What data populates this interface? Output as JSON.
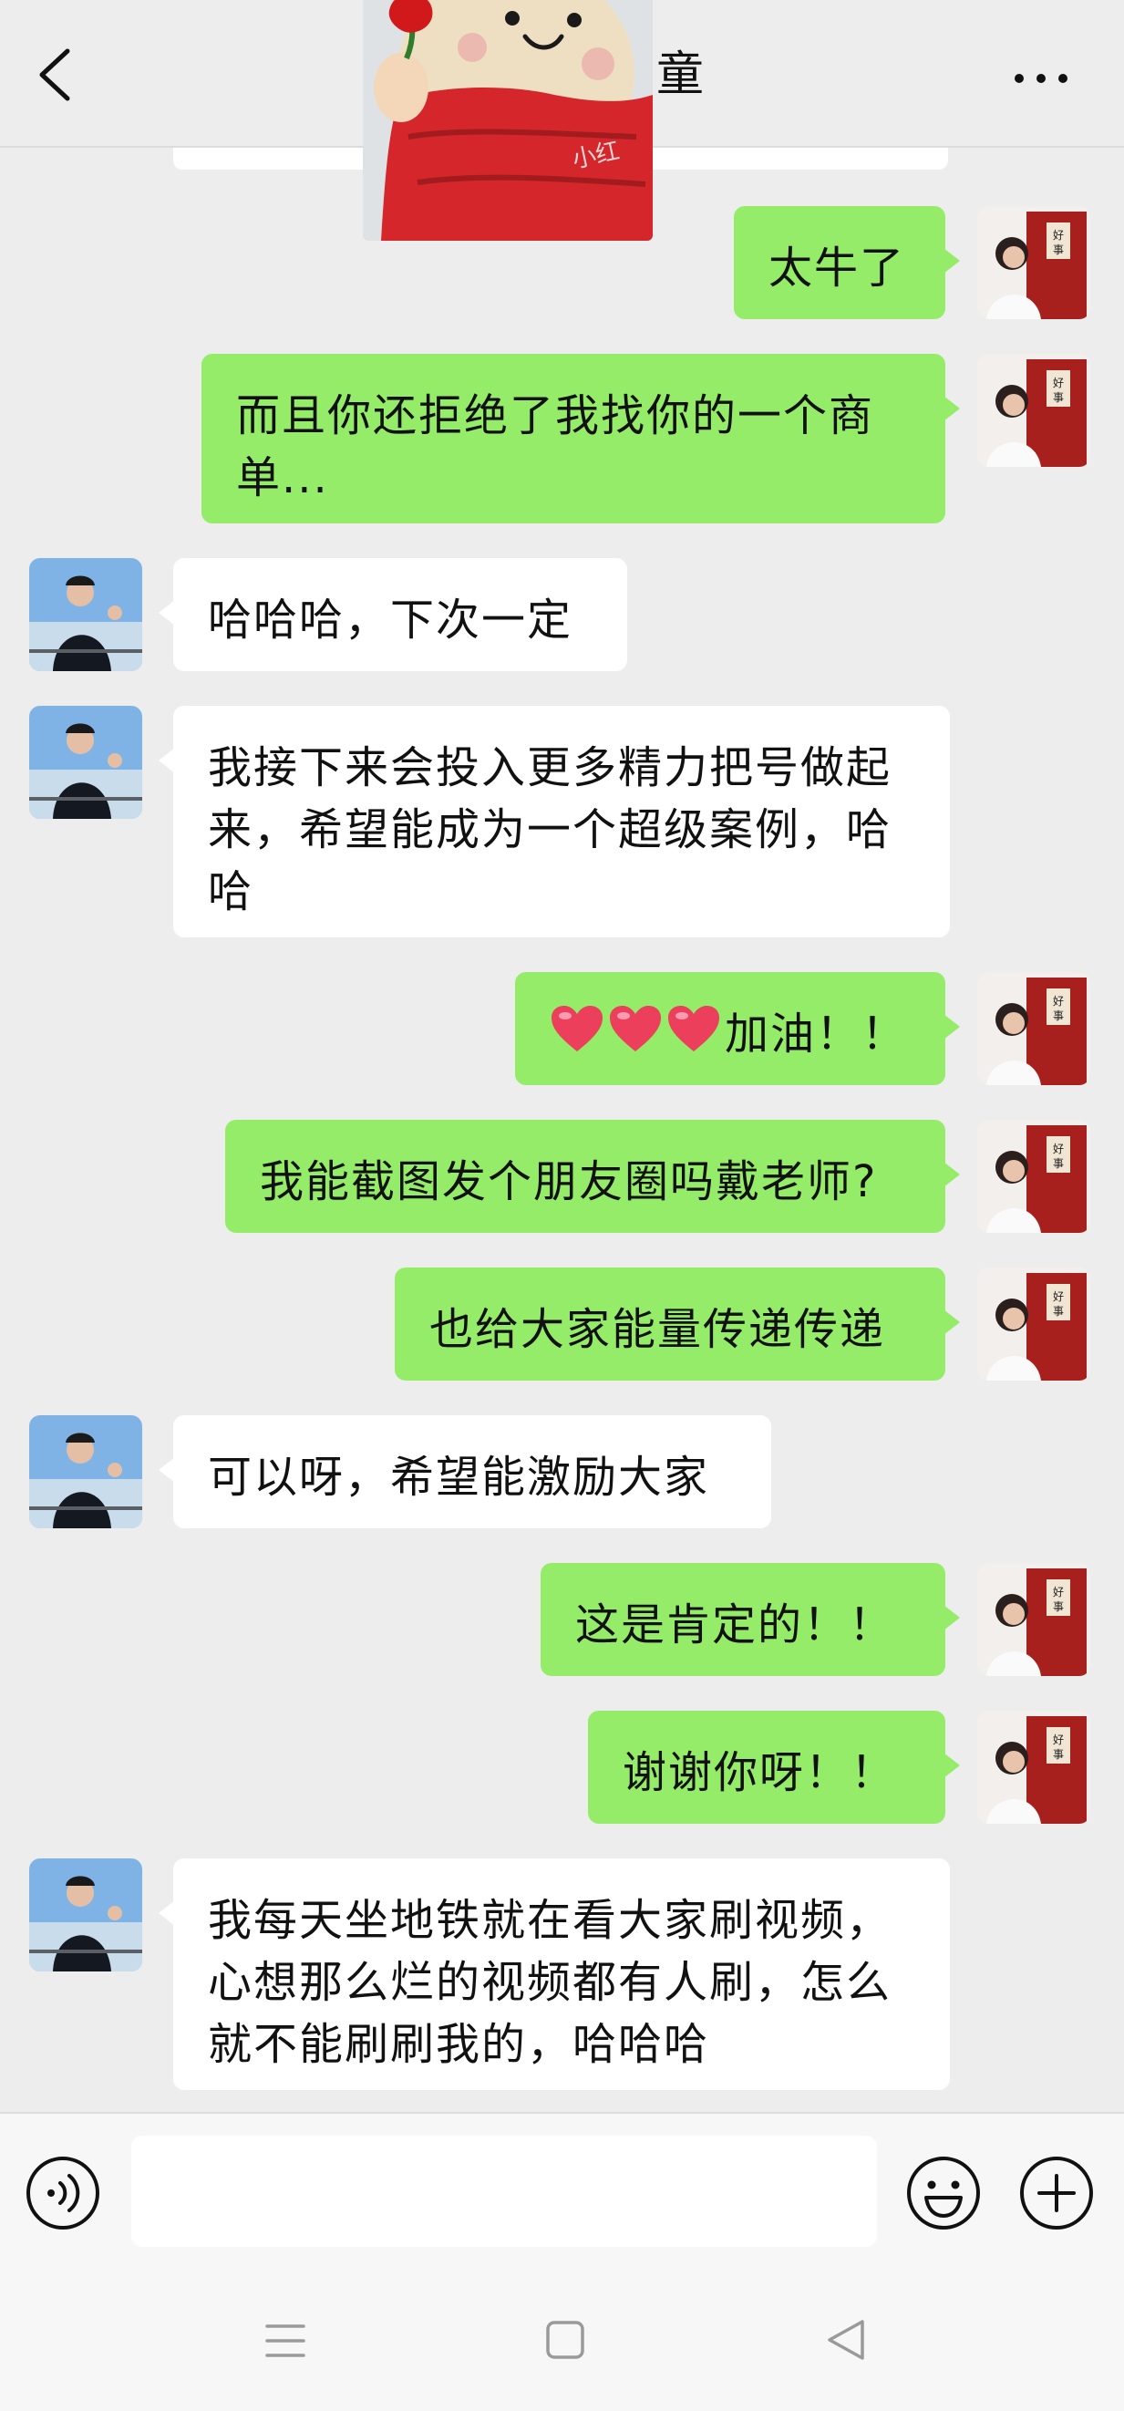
{
  "header": {
    "title": "童",
    "back_icon": "chevron-left-icon",
    "more_icon": "ellipsis-icon"
  },
  "colors": {
    "background": "#ededed",
    "my_bubble": "#95ec69",
    "their_bubble": "#ffffff"
  },
  "messages": [
    {
      "from": "me",
      "text": "太牛了"
    },
    {
      "from": "me",
      "text": "而且你还拒绝了我找你的一个商\n单..."
    },
    {
      "from": "them",
      "text": "哈哈哈，下次一定"
    },
    {
      "from": "them",
      "text": "我接下来会投入更多精力把号做起\n来，希望能成为一个超级案例，哈\n哈"
    },
    {
      "from": "me",
      "text": "加油！！",
      "prefix_icons": [
        "heart-icon",
        "heart-icon",
        "heart-icon"
      ]
    },
    {
      "from": "me",
      "text": "我能截图发个朋友圈吗戴老师?"
    },
    {
      "from": "me",
      "text": "也给大家能量传递传递"
    },
    {
      "from": "them",
      "text": "可以呀，希望能激励大家"
    },
    {
      "from": "me",
      "text": "这是肯定的！！"
    },
    {
      "from": "me",
      "text": "谢谢你呀！！"
    },
    {
      "from": "them",
      "text": "我每天坐地铁就在看大家刷视频，\n心想那么烂的视频都有人刷，怎么\n就不能刷刷我的，哈哈哈"
    }
  ],
  "input": {
    "value": "",
    "voice_icon": "voice-icon",
    "emoji_icon": "emoji-icon",
    "plus_icon": "plus-icon"
  },
  "navbar": {
    "icons": [
      "menu-icon",
      "home-icon",
      "back-triangle-icon"
    ]
  }
}
